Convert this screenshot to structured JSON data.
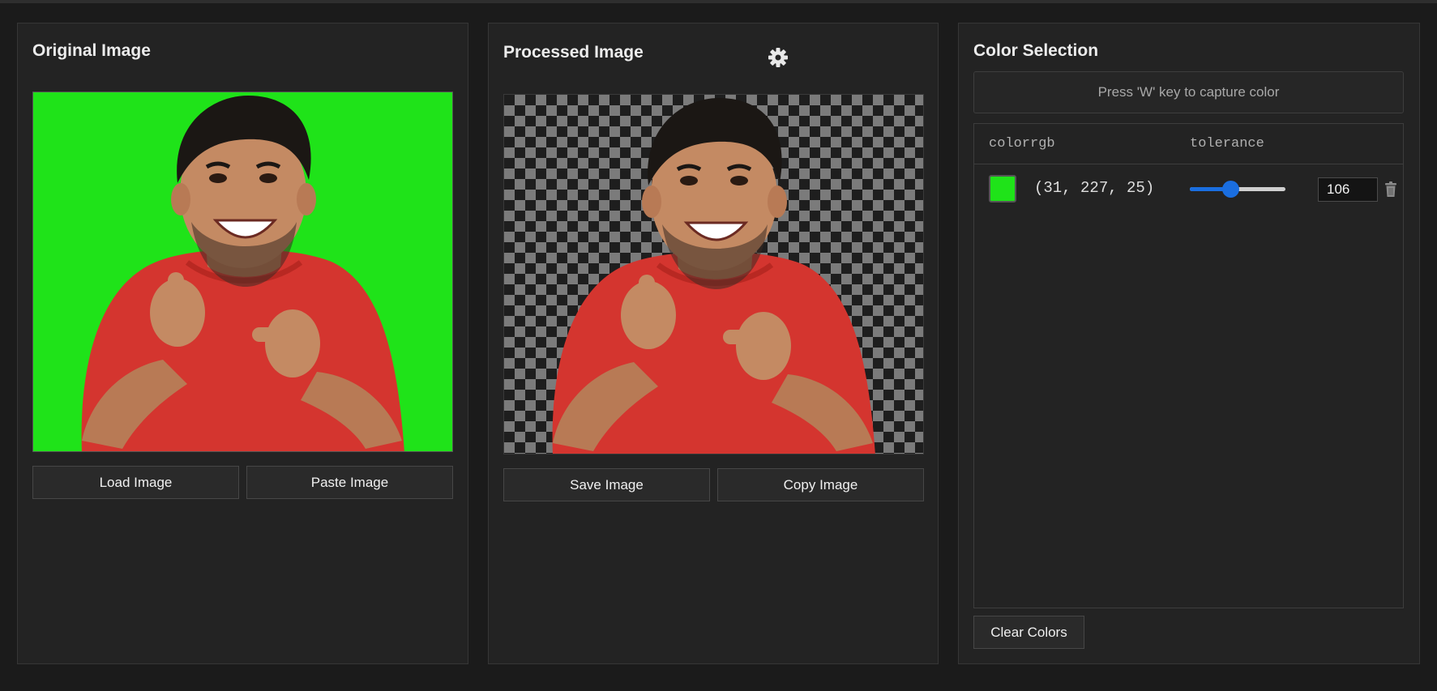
{
  "original_panel": {
    "title": "Original Image",
    "load_button": "Load Image",
    "paste_button": "Paste Image",
    "background_color": "#1fe319"
  },
  "processed_panel": {
    "title": "Processed Image",
    "settings_icon": "gear-icon",
    "save_button": "Save Image",
    "copy_button": "Copy Image"
  },
  "color_panel": {
    "title": "Color Selection",
    "capture_hint": "Press 'W' key to capture color",
    "table": {
      "col_color": "colorrgb",
      "col_tolerance": "tolerance",
      "rows": [
        {
          "swatch": "#1fe319",
          "rgb": "(31, 227, 25)",
          "tolerance": "106",
          "slider_fraction": 0.42
        }
      ]
    },
    "clear_button": "Clear Colors"
  },
  "colors": {
    "accent": "#1a6ee0",
    "shirt": "#d8332e",
    "skin": "#c48a63",
    "hair": "#1b1714"
  }
}
